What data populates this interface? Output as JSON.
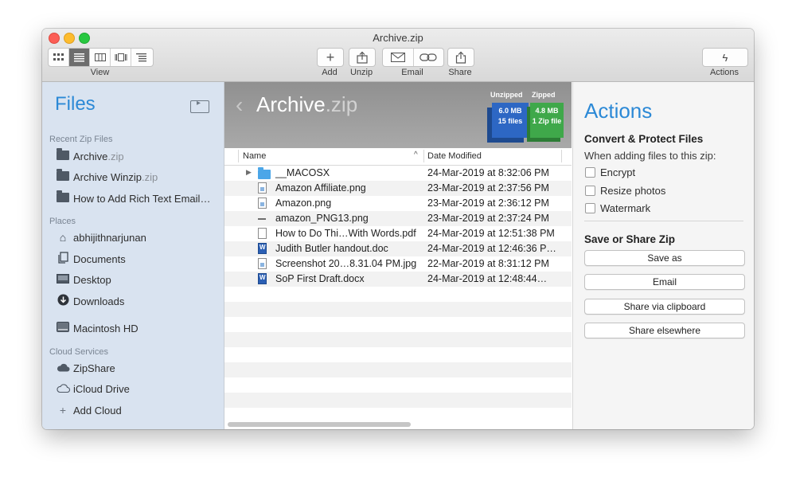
{
  "window": {
    "title": "Archive.zip"
  },
  "toolbar": {
    "view_label": "View",
    "add_label": "Add",
    "unzip_label": "Unzip",
    "email_label": "Email",
    "share_label": "Share",
    "actions_label": "Actions",
    "view_modes": [
      "grid-icon",
      "list-icon",
      "columns-icon",
      "gallery-icon",
      "outline-icon"
    ],
    "active_view_mode": 1
  },
  "sidebar": {
    "title": "Files",
    "recent_header": "Recent Zip Files",
    "recent": [
      {
        "name": "Archive",
        "ext": ".zip"
      },
      {
        "name": "Archive Winzip",
        "ext": ".zip"
      },
      {
        "name": "How to Add Rich Text Email…",
        "ext": ""
      }
    ],
    "places_header": "Places",
    "places": [
      {
        "label": "abhijithnarjunan",
        "icon": "home-icon"
      },
      {
        "label": "Documents",
        "icon": "documents-icon"
      },
      {
        "label": "Desktop",
        "icon": "desktop-icon"
      },
      {
        "label": "Downloads",
        "icon": "downloads-icon"
      },
      {
        "label": "Macintosh HD",
        "icon": "disk-icon"
      }
    ],
    "cloud_header": "Cloud Services",
    "cloud": [
      {
        "label": "ZipShare",
        "icon": "cloud-filled-icon"
      },
      {
        "label": "iCloud Drive",
        "icon": "cloud-outline-icon"
      },
      {
        "label": "Add Cloud",
        "icon": "plus-icon"
      }
    ]
  },
  "archive": {
    "name": "Archive",
    "ext": ".zip",
    "unzipped_label": "Unzipped",
    "zipped_label": "Zipped",
    "unzipped_size": "6.0 MB",
    "unzipped_count": "15 files",
    "zipped_size": "4.8 MB",
    "zipped_count": "1 Zip file"
  },
  "file_list": {
    "col_name": "Name",
    "col_date": "Date Modified",
    "rows": [
      {
        "name": "__MACOSX",
        "date": "24-Mar-2019 at 8:32:06 PM",
        "type": "folder"
      },
      {
        "name": "Amazon Affiliate.png",
        "date": "23-Mar-2019 at 2:37:56 PM",
        "type": "image"
      },
      {
        "name": "Amazon.png",
        "date": "23-Mar-2019 at 2:36:12 PM",
        "type": "image"
      },
      {
        "name": "amazon_PNG13.png",
        "date": "23-Mar-2019 at 2:37:24 PM",
        "type": "dash"
      },
      {
        "name": "How to Do Thi…With Words.pdf",
        "date": "24-Mar-2019 at 12:51:38 PM",
        "type": "doc"
      },
      {
        "name": "Judith Butler handout.doc",
        "date": "24-Mar-2019 at 12:46:36 P…",
        "type": "doc"
      },
      {
        "name": "Screenshot 20…8.31.04 PM.jpg",
        "date": "22-Mar-2019 at 8:31:12 PM",
        "type": "image"
      },
      {
        "name": "SoP First Draft.docx",
        "date": "24-Mar-2019 at 12:48:44…",
        "type": "word"
      }
    ]
  },
  "actions": {
    "title": "Actions",
    "convert_header": "Convert & Protect Files",
    "convert_sub": "When adding files to this zip:",
    "encrypt_label": "Encrypt",
    "resize_label": "Resize photos",
    "watermark_label": "Watermark",
    "share_header": "Save or Share Zip",
    "save_as_label": "Save as",
    "email_label": "Email",
    "clipboard_label": "Share via clipboard",
    "elsewhere_label": "Share elsewhere"
  }
}
